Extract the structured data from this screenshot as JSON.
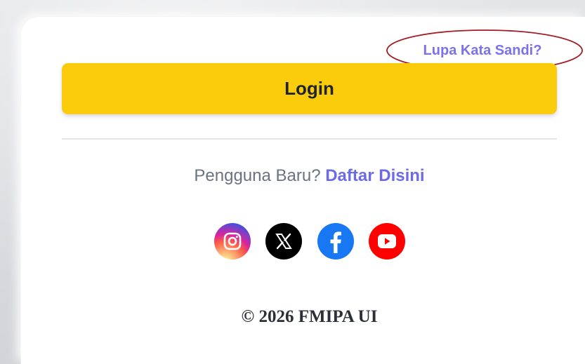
{
  "auth": {
    "forgot_password_label": "Lupa Kata Sandi?",
    "login_label": "Login",
    "new_user_prompt": "Pengguna Baru?",
    "signup_label": "Daftar Disini"
  },
  "socials": [
    {
      "name": "instagram",
      "icon": "instagram-icon",
      "color": "#d6249f"
    },
    {
      "name": "x",
      "icon": "x-icon",
      "color": "#000000"
    },
    {
      "name": "facebook",
      "icon": "facebook-icon",
      "color": "#1877f2"
    },
    {
      "name": "youtube",
      "icon": "youtube-icon",
      "color": "#ff0000"
    }
  ],
  "footer": {
    "copyright": "© 2026 FMIPA UI"
  },
  "colors": {
    "accent": "#7b72e9",
    "button": "#facc0c",
    "annotation": "#a31d24"
  }
}
